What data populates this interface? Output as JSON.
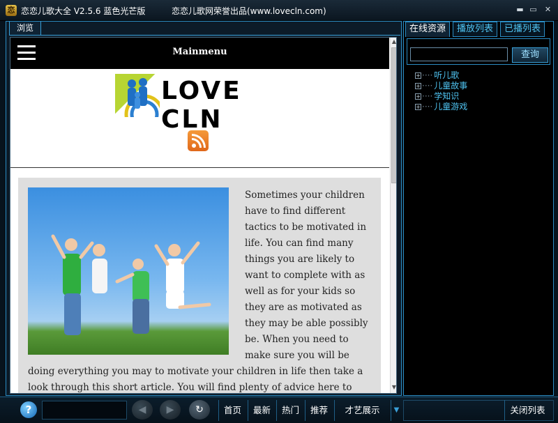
{
  "window": {
    "app_icon_glyph": "恋",
    "title": "恋恋儿歌大全  V2.5.6  蓝色光芒版",
    "publisher": "恋恋儿歌网荣誉出品(www.lovecln.com)",
    "minimize_glyph": "▬",
    "maximize_glyph": "▭",
    "close_glyph": "✕"
  },
  "browser": {
    "tab_label": "浏览",
    "page": {
      "menu_title": "Mainmenu",
      "logo_text": "LOVE CLN",
      "article_text": "Sometimes your children have to find different tactics to be motivated in life. You can find many things you are likely to want to complete with as well as for your kids so they are as motivated as they may be able possibly be. When you need to make sure you will be doing everything you may to motivate your children in life then take a look through this short article. You will find plenty of advice here to"
    },
    "scroll_up_glyph": "▲",
    "scroll_down_glyph": "▼"
  },
  "sidebar": {
    "tabs": [
      {
        "label": "在线资源",
        "active": true
      },
      {
        "label": "播放列表",
        "active": false
      },
      {
        "label": "已播列表",
        "active": false
      }
    ],
    "search": {
      "value": "",
      "button_label": "查询"
    },
    "tree": [
      {
        "expander": "+",
        "connector": "····",
        "label": "听儿歌"
      },
      {
        "expander": "+",
        "connector": "····",
        "label": "儿童故事"
      },
      {
        "expander": "+",
        "connector": "····",
        "label": "学知识"
      },
      {
        "expander": "+",
        "connector": "····",
        "label": "儿童游戏"
      }
    ]
  },
  "bottom": {
    "help_glyph": "?",
    "back_glyph": "◀",
    "forward_glyph": "▶",
    "refresh_glyph": "↻",
    "links": {
      "home": "首页",
      "newest": "最新",
      "hot": "热门",
      "recommend": "推荐",
      "show": "才艺展示"
    },
    "dropdown_glyph": "▼",
    "close_list": "关闭列表"
  },
  "colors": {
    "accent": "#2b8dc4",
    "link": "#4fc3f1",
    "rss": "#f08a2c",
    "logo_green": "#b7d533"
  }
}
